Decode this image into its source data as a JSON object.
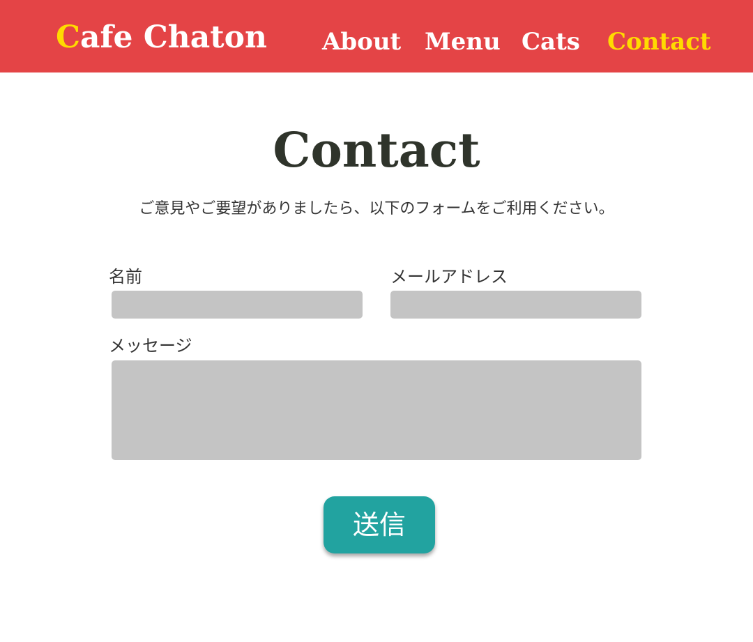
{
  "header": {
    "logo_first_letter": "C",
    "logo_rest": "afe Chaton",
    "nav": {
      "about": "About",
      "menu": "Menu",
      "cats": "Cats",
      "contact": "Contact"
    },
    "active_nav": "Contact"
  },
  "main": {
    "title": "Contact",
    "intro": "ご意見やご要望がありましたら、以下のフォームをご利用ください。"
  },
  "form": {
    "name_label": "名前",
    "name_value": "",
    "email_label": "メールアドレス",
    "email_value": "",
    "message_label": "メッセージ",
    "message_value": "",
    "submit_label": "送信"
  },
  "colors": {
    "header_bg": "#e44446",
    "accent_yellow": "#ffdb00",
    "text_dark": "#2f342b",
    "field_bg": "#c4c4c4",
    "button_teal": "#22a3a0"
  }
}
